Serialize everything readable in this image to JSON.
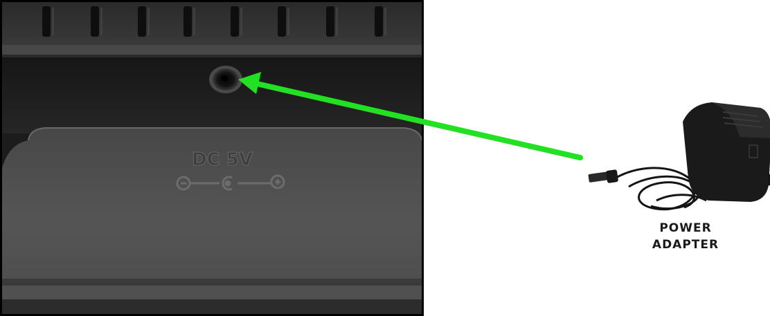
{
  "photo": {
    "embossed_text": "DC 5V",
    "polarity_symbols": [
      "⊖",
      "C",
      "⊕"
    ]
  },
  "adapter": {
    "caption_line1": "POWER",
    "caption_line2": "ADAPTER"
  },
  "colors": {
    "arrow": "#22e022",
    "panel_dark": "#1c1c1c",
    "panel_mid": "#3a3a3a",
    "panel_light": "#5a5a5a"
  }
}
